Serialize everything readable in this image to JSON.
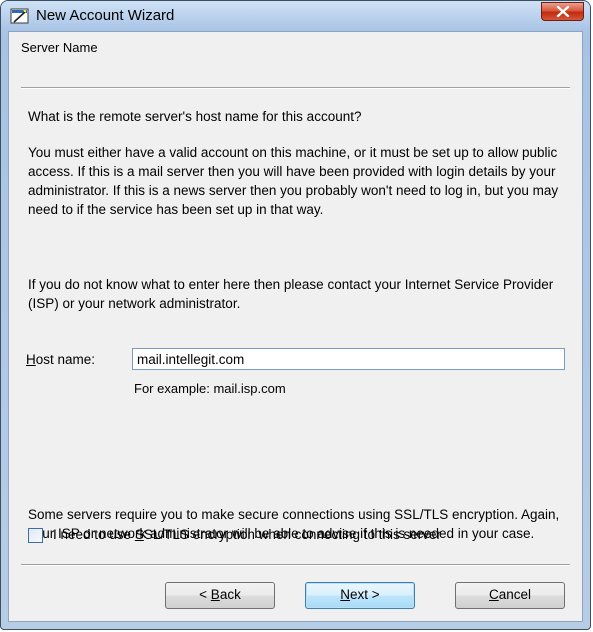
{
  "window": {
    "title": "New Account Wizard",
    "close_glyph": "X"
  },
  "page": {
    "section_title": "Server Name",
    "question": "What is the remote server's host name for this account?",
    "paragraph1": "You must either have a valid account on this machine, or it must be set up to allow public access.  If this is a mail server then you will have been provided with login details by your administrator.  If this is a news server then you probably won't need to log in, but you may need to if the service has been set up in that way.",
    "paragraph2": "If you do not know what to enter here then please contact your Internet Service Provider (ISP) or your network administrator.",
    "paragraph3": "Some servers require you to make secure connections using SSL/TLS encryption.  Again, your ISP or network administrator will be able to advise if this is needed in your case."
  },
  "host": {
    "label_accel": "H",
    "label_rest": "ost name:",
    "value": "mail.intellegit.com",
    "example": "For example: mail.isp.com"
  },
  "ssl": {
    "checked": false,
    "label_pre": "I need to use ",
    "label_accel": "S",
    "label_post": "SL/TLS encryption when connecting to this server"
  },
  "buttons": {
    "back_pre": "< ",
    "back_accel": "B",
    "back_post": "ack",
    "next_accel": "N",
    "next_post": "ext >",
    "cancel_accel": "C",
    "cancel_post": "ancel"
  },
  "icons": {
    "app": "wizard-icon",
    "close": "close-icon"
  }
}
